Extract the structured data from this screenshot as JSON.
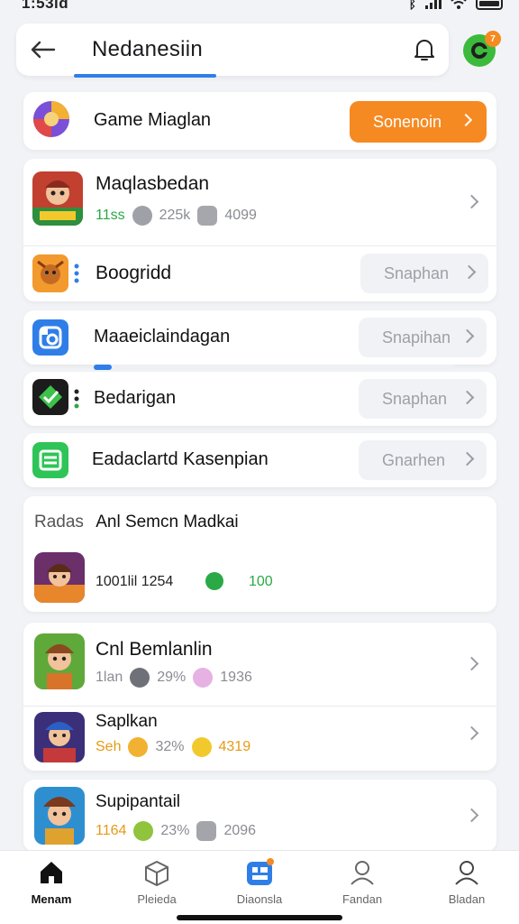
{
  "status_bar": {
    "time": "1:53id"
  },
  "header": {
    "search_text": "Nedanesiin",
    "notification_count": "7"
  },
  "banner": {
    "title": "Game Miaglan",
    "button_label": "Sonenoin"
  },
  "group1": {
    "rows": [
      {
        "title": "Maqlasbedan",
        "stat1": "11ss",
        "stat2": "225k",
        "stat3": "4099",
        "icon": "cartoon-hero-icon"
      },
      {
        "title": "Boogridd",
        "button": "Snaphan",
        "icon": "cartoon-bear-icon"
      }
    ]
  },
  "list2": [
    {
      "title": "Maaeiclaindagan",
      "button": "Snapihan",
      "progress": 0.05,
      "icon": "camera-app-icon"
    },
    {
      "title": "Bedarigan",
      "button": "Snaphan",
      "icon": "green-gem-icon"
    },
    {
      "title": "Eadaclartd Kasenpian",
      "button": "Gnarhen",
      "icon": "document-list-icon"
    }
  ],
  "section": {
    "heading_prefix": "Radas",
    "heading": "Anl Semcn Madkai",
    "item": {
      "code": "1001lil 1254",
      "score": "100",
      "icon": "cartoon-adventurer-icon"
    }
  },
  "group3": {
    "rows": [
      {
        "title": "Cnl Bemlanlin",
        "stat1": "1lan",
        "stat2": "29%",
        "stat3": "1936",
        "icon": "cartoon-explorer-icon"
      },
      {
        "title": "Saplkan",
        "stat1": "Seh",
        "stat2": "32%",
        "stat3": "4319",
        "icon": "cartoon-hero-blue-icon"
      }
    ]
  },
  "group4": {
    "rows": [
      {
        "title": "Supipantail",
        "stat1": "1164",
        "stat2": "23%",
        "stat3": "2096",
        "icon": "cartoon-pirate-icon"
      }
    ]
  },
  "bottom_nav": [
    {
      "label": "Menam",
      "icon": "home-icon",
      "active": true
    },
    {
      "label": "Pleieda",
      "icon": "box-icon"
    },
    {
      "label": "Diaonsla",
      "icon": "apps-icon"
    },
    {
      "label": "Fandan",
      "icon": "profile-icon"
    },
    {
      "label": "Bladan",
      "icon": "user-icon"
    }
  ],
  "colors": {
    "accent": "#2f7ee8",
    "orange": "#f58a22",
    "green": "#2aa946"
  }
}
